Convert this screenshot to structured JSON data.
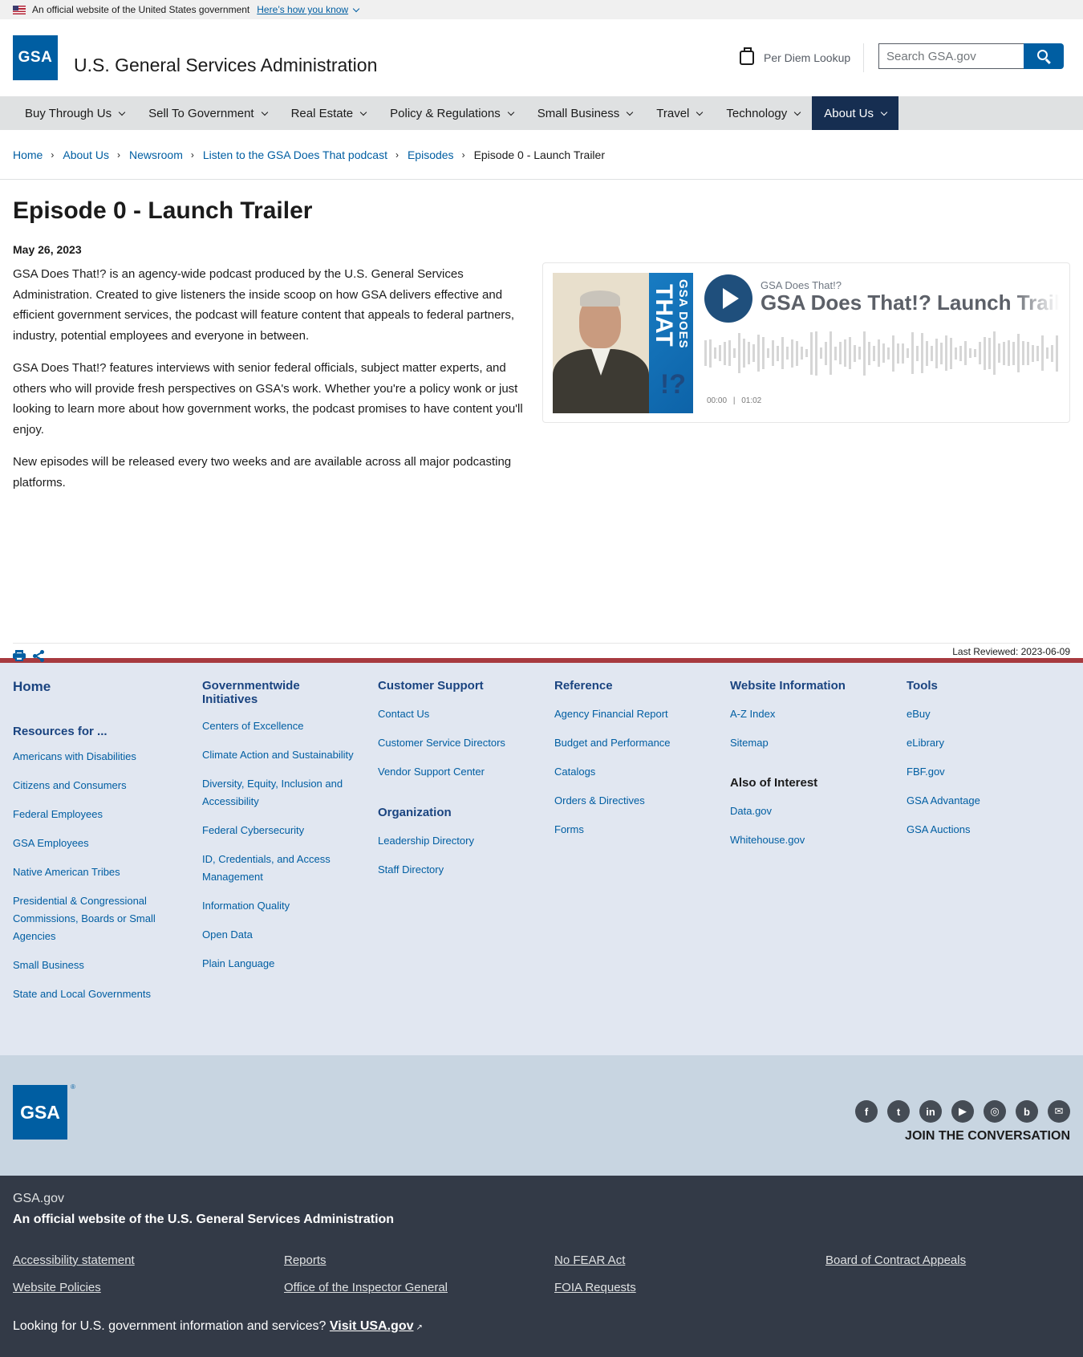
{
  "banner": {
    "text": "An official website of the United States government",
    "link": "Here’s how you know"
  },
  "header": {
    "logo": "GSA",
    "title": "U.S. General Services Administration",
    "per_diem": "Per Diem Lookup",
    "search_placeholder": "Search GSA.gov"
  },
  "nav": [
    {
      "label": "Buy Through Us"
    },
    {
      "label": "Sell To Government"
    },
    {
      "label": "Real Estate"
    },
    {
      "label": "Policy & Regulations"
    },
    {
      "label": "Small Business"
    },
    {
      "label": "Travel"
    },
    {
      "label": "Technology"
    },
    {
      "label": "About Us"
    }
  ],
  "breadcrumb": [
    "Home",
    "About Us",
    "Newsroom",
    "Listen to the GSA Does That podcast",
    "Episodes",
    "Episode 0 - Launch Trailer"
  ],
  "page": {
    "title": "Episode 0 - Launch Trailer",
    "date": "May 26, 2023",
    "paragraphs": [
      "GSA Does That!? is an agency-wide podcast produced by the U.S. General Services Administration. Created to give listeners the inside scoop on how GSA delivers effective and efficient government services, the podcast will feature content that appeals to federal partners, industry, potential employees and everyone in between.",
      "GSA Does That!? features interviews with senior federal officials, subject matter experts, and others who will provide fresh perspectives on GSA's work. Whether you're a policy wonk or just looking to learn more about how government works, the podcast promises to have content you'll enjoy.",
      "New episodes will be released every two weeks and are available across all major podcasting platforms."
    ],
    "last_reviewed": "Last Reviewed: 2023-06-09"
  },
  "player": {
    "cover_text": "GSA DOES",
    "cover_big": "THAT",
    "cover_q": "!?",
    "podcast": "GSA Does That!?",
    "episode": "GSA Does That!? Launch Trailer",
    "current_time": "00:00",
    "divider": "|",
    "duration": "01:02",
    "progress_fraction": 0
  },
  "footer": {
    "home": "Home",
    "resources_heading": "Resources for ...",
    "resources": [
      "Americans with Disabilities",
      "Citizens and Consumers",
      "Federal Employees",
      "GSA Employees",
      "Native American Tribes",
      "Presidential & Congressional Commissions, Boards or Small Agencies",
      "Small Business",
      "State and Local Governments"
    ],
    "initiatives_heading": "Governmentwide Initiatives",
    "initiatives": [
      "Centers of Excellence",
      "Climate Action and Sustainability",
      "Diversity, Equity, Inclusion and Accessibility",
      "Federal Cybersecurity",
      "ID, Credentials, and Access Management",
      "Information Quality",
      "Open Data",
      "Plain Language"
    ],
    "support_heading": "Customer Support",
    "support": [
      "Contact Us",
      "Customer Service Directors",
      "Vendor Support Center"
    ],
    "org_heading": "Organization",
    "org": [
      "Leadership Directory",
      "Staff Directory"
    ],
    "reference_heading": "Reference",
    "reference": [
      "Agency Financial Report",
      "Budget and Performance",
      "Catalogs",
      "Orders & Directives",
      "Forms"
    ],
    "website_heading": "Website Information",
    "website": [
      "A-Z Index",
      "Sitemap"
    ],
    "interest_heading": "Also of Interest",
    "interest": [
      "Data.gov",
      "Whitehouse.gov"
    ],
    "tools_heading": "Tools",
    "tools": [
      "eBuy",
      "eLibrary",
      "FBF.gov",
      "GSA Advantage",
      "GSA Auctions"
    ]
  },
  "social": {
    "logo": "GSA",
    "reg": "®",
    "icons": [
      {
        "name": "facebook-icon",
        "glyph": "f"
      },
      {
        "name": "twitter-icon",
        "glyph": "t"
      },
      {
        "name": "linkedin-icon",
        "glyph": "in"
      },
      {
        "name": "youtube-icon",
        "glyph": "▶"
      },
      {
        "name": "instagram-icon",
        "glyph": "◎"
      },
      {
        "name": "blog-icon",
        "glyph": "b"
      },
      {
        "name": "email-icon",
        "glyph": "✉"
      }
    ],
    "join": "JOIN THE CONVERSATION"
  },
  "bottom": {
    "site": "GSA.gov",
    "official": "An official website of the U.S. General Services Administration",
    "links": [
      "Accessibility statement",
      "Reports",
      "No FEAR Act",
      "Board of Contract Appeals",
      "Website Policies",
      "Office of the Inspector General",
      "FOIA Requests"
    ],
    "usa_text": "Looking for U.S. government information and services?",
    "usa_link": "Visit USA.gov",
    "ext_icon": "↗"
  },
  "colors": {
    "primary": "#005ea2",
    "nav_active": "#162e51",
    "footer_red": "#a73a3f",
    "footer_bg": "#e1e7f1",
    "bottom_bg": "#333a47"
  }
}
